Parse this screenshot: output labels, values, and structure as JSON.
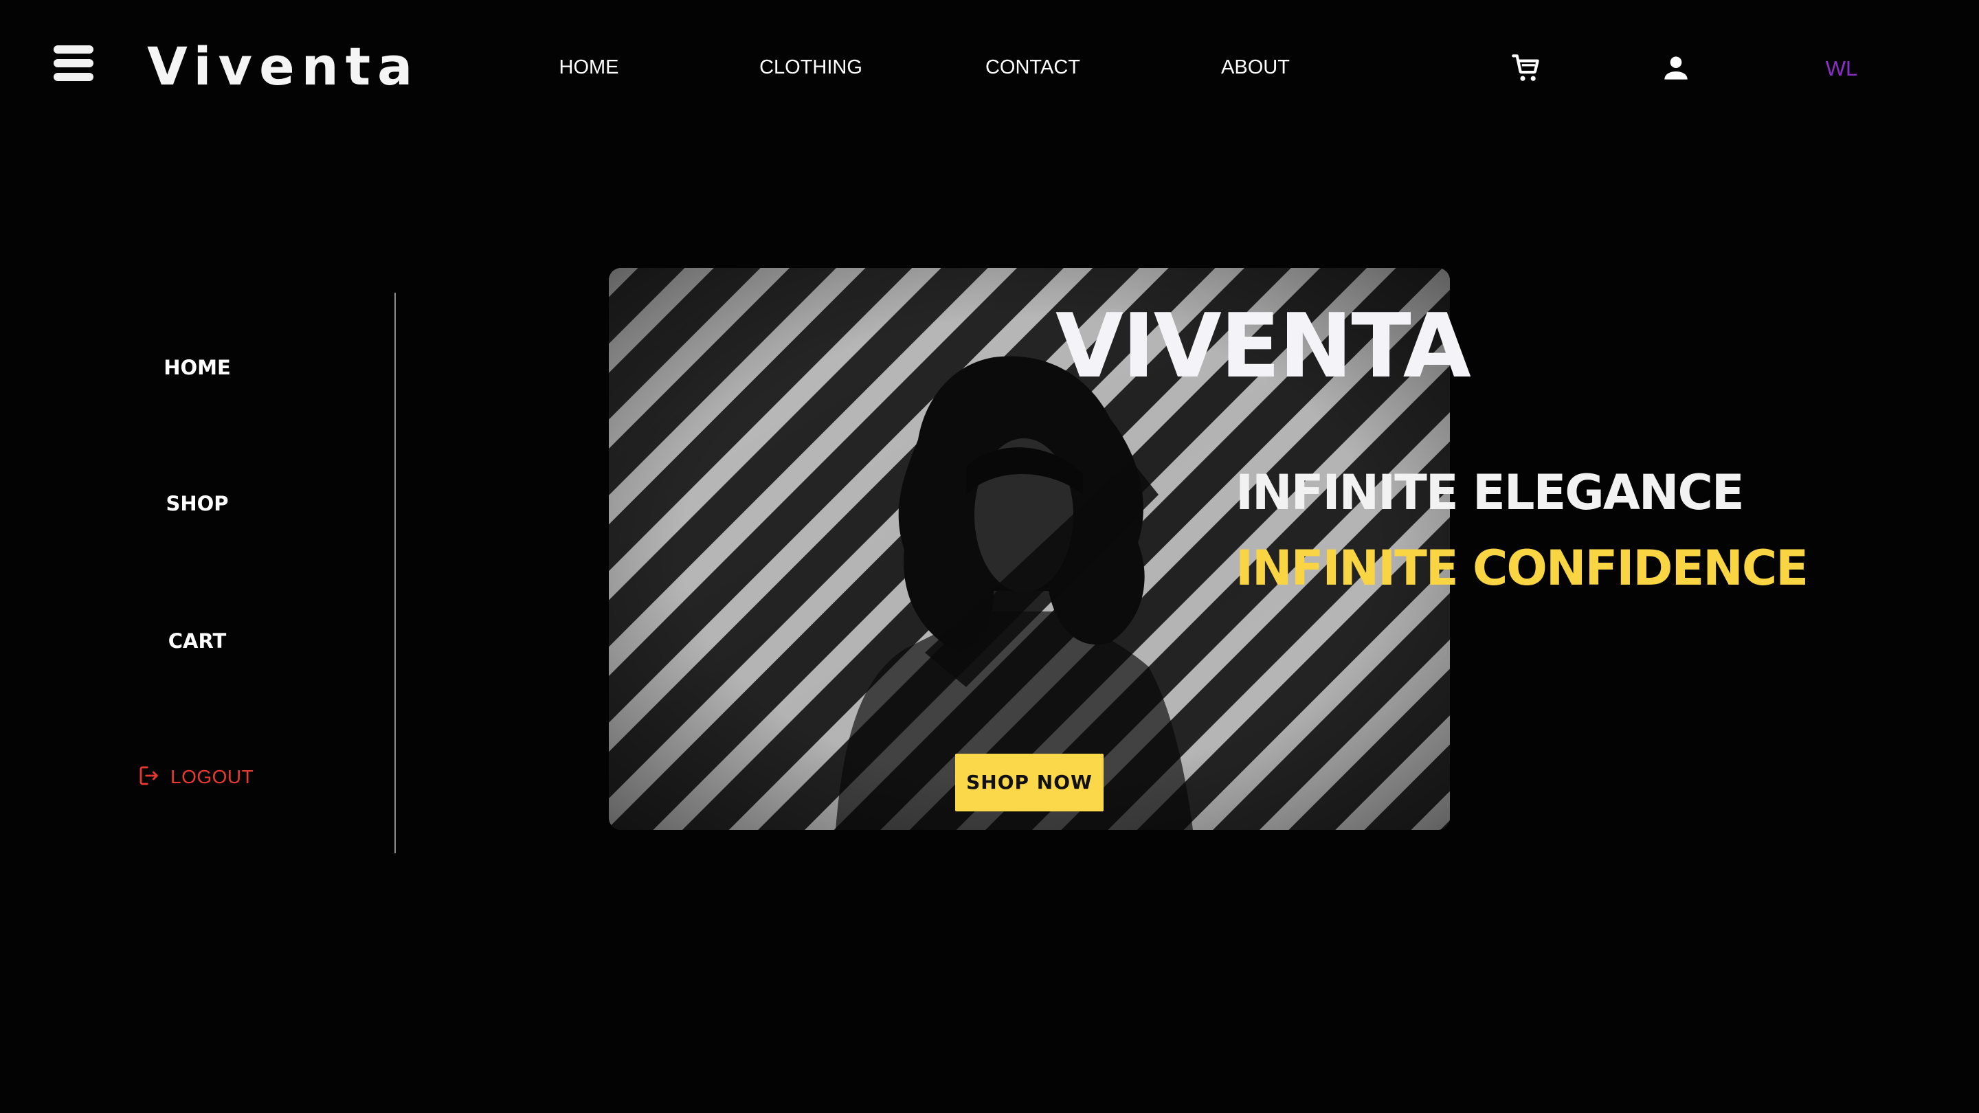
{
  "header": {
    "brand": "Viventa",
    "nav": [
      "HOME",
      "CLOTHING",
      "CONTACT",
      "ABOUT"
    ],
    "user_initials": "WL",
    "icons": {
      "menu": "hamburger-menu-icon",
      "cart": "shopping-cart-icon",
      "account": "user-account-icon"
    }
  },
  "sidebar": {
    "items": [
      "HOME",
      "SHOP",
      "CART"
    ],
    "logout_label": "LOGOUT",
    "logout_icon": "logout-icon"
  },
  "hero": {
    "title": "VIVENTA",
    "tagline_1": "INFINITE ELEGANCE",
    "tagline_2": "INFINITE CONFIDENCE",
    "cta_label": "SHOP NOW",
    "image": "black-and-white photo of a curly-haired woman with diagonal light stripes"
  },
  "colors": {
    "background": "#030303",
    "accent_yellow": "#fad543",
    "initials_purple": "#8a2fc6",
    "logout_red": "#e8382f"
  }
}
